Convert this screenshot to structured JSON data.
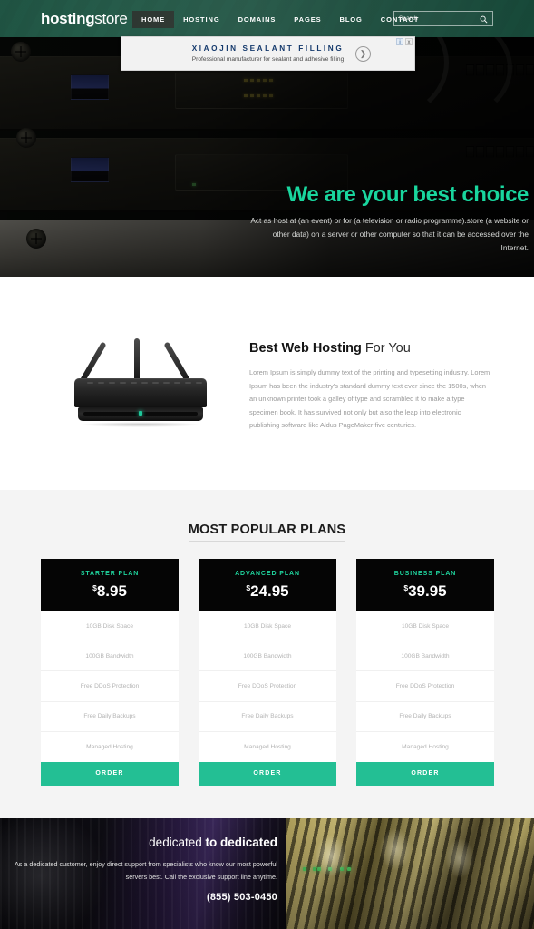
{
  "header": {
    "logo_bold": "hosting",
    "logo_light": "store",
    "nav": [
      {
        "label": "HOME",
        "active": true
      },
      {
        "label": "HOSTING",
        "active": false
      },
      {
        "label": "DOMAINS",
        "active": false
      },
      {
        "label": "PAGES",
        "active": false
      },
      {
        "label": "BLOG",
        "active": false
      },
      {
        "label": "CONTACT",
        "active": false
      }
    ],
    "search": {
      "placeholder": "Search",
      "value": "",
      "icon": "search-icon"
    }
  },
  "ad": {
    "title": "XIAOJIN SEALANT FILLING",
    "subtitle": "Professional manufacturer for sealant and adhesive filling",
    "arrow_icon": "chevron-right-icon",
    "info_badge": "i",
    "close_badge": "x"
  },
  "hero": {
    "title": "We are your best choice",
    "subtitle": "Act as host at (an event) or for (a television or radio programme).store (a website or other data) on a server or other computer so that it can be accessed over the Internet.",
    "accent_color": "#19d69e"
  },
  "about": {
    "title_bold": "Best Web Hosting",
    "title_rest": " For You",
    "body": "Lorem Ipsum is simply dummy text of the printing and typesetting industry. Lorem Ipsum has been the industry's standard dummy text ever since the 1500s, when an unknown printer took a galley of type and scrambled it to make a type specimen book. It has survived not only but also the leap into electronic publishing software like Aldus PageMaker five centuries.",
    "image_name": "wireless-router-image"
  },
  "plans": {
    "heading": "MOST POPULAR PLANS",
    "order_label": "ORDER",
    "accent_color": "#23bf94",
    "plan_name_color": "#1fd49d",
    "items": [
      {
        "name": "STARTER PLAN",
        "currency": "$",
        "price": "8.95",
        "features": [
          "10GB Disk Space",
          "100GB Bandwidth",
          "Free DDoS Protection",
          "Free Daily Backups",
          "Managed Hosting"
        ]
      },
      {
        "name": "ADVANCED PLAN",
        "currency": "$",
        "price": "24.95",
        "features": [
          "10GB Disk Space",
          "100GB Bandwidth",
          "Free DDoS Protection",
          "Free Daily Backups",
          "Managed Hosting"
        ]
      },
      {
        "name": "BUSINESS PLAN",
        "currency": "$",
        "price": "39.95",
        "features": [
          "10GB Disk Space",
          "100GB Bandwidth",
          "Free DDoS Protection",
          "Free Daily Backups",
          "Managed Hosting"
        ]
      }
    ]
  },
  "dedicated": {
    "title_thin": "dedicated ",
    "title_bold": "to dedicated",
    "body": "As a dedicated customer, enjoy direct support from specialists who know our most powerful servers best. Call the exclusive support line anytime.",
    "phone": "(855) 503-0450"
  }
}
